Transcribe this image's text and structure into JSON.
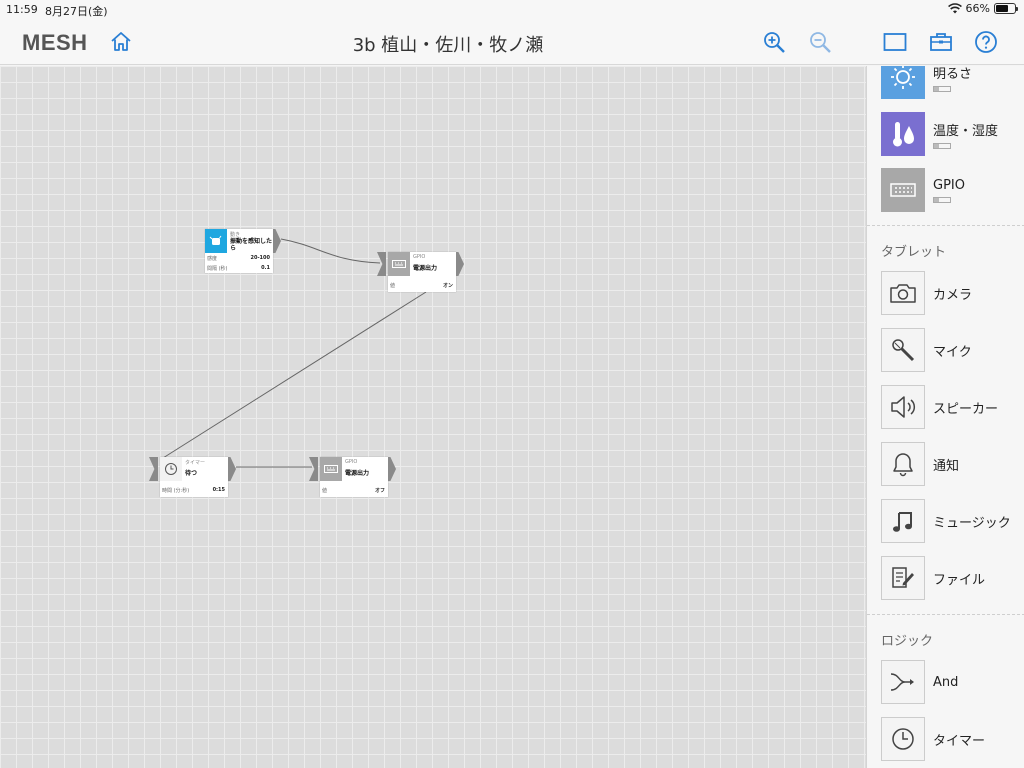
{
  "status": {
    "time": "11:59",
    "date": "8月27日(金)",
    "battery": "66%",
    "battery_level": 0.66
  },
  "nav": {
    "logo": "MESH",
    "title": "3b 植山・佐川・牧ノ瀬"
  },
  "blocks": {
    "motion": {
      "category": "動き",
      "name": "振動を感知したら",
      "row1_label": "感度",
      "row1_value": "20-100",
      "row2_label": "間隔 (秒)",
      "row2_value": "0.1",
      "color": "#1fa7e0"
    },
    "gpio1": {
      "category": "GPIO",
      "name": "電源出力",
      "row1_label": "値",
      "row1_value": "オン"
    },
    "timer": {
      "category": "タイマー",
      "name": "待つ",
      "row1_label": "時間 (分:秒)",
      "row1_value": "0:15"
    },
    "gpio2": {
      "category": "GPIO",
      "name": "電源出力",
      "row1_label": "値",
      "row1_value": "オフ"
    }
  },
  "sidebar": {
    "tags": [
      {
        "label": "明るさ",
        "color": "#5aa0e0"
      },
      {
        "label": "温度・湿度",
        "color": "#7a6fd0"
      },
      {
        "label": "GPIO",
        "color": "#a8a8a8"
      }
    ],
    "tablet_section": "タブレット",
    "tablet": [
      {
        "label": "カメラ"
      },
      {
        "label": "マイク"
      },
      {
        "label": "スピーカー"
      },
      {
        "label": "通知"
      },
      {
        "label": "ミュージック"
      },
      {
        "label": "ファイル"
      }
    ],
    "logic_section": "ロジック",
    "logic": [
      {
        "label": "And"
      },
      {
        "label": "タイマー"
      }
    ]
  },
  "colors": {
    "accent": "#2a7fd4",
    "gpio_tile": "#a8a8a8"
  }
}
